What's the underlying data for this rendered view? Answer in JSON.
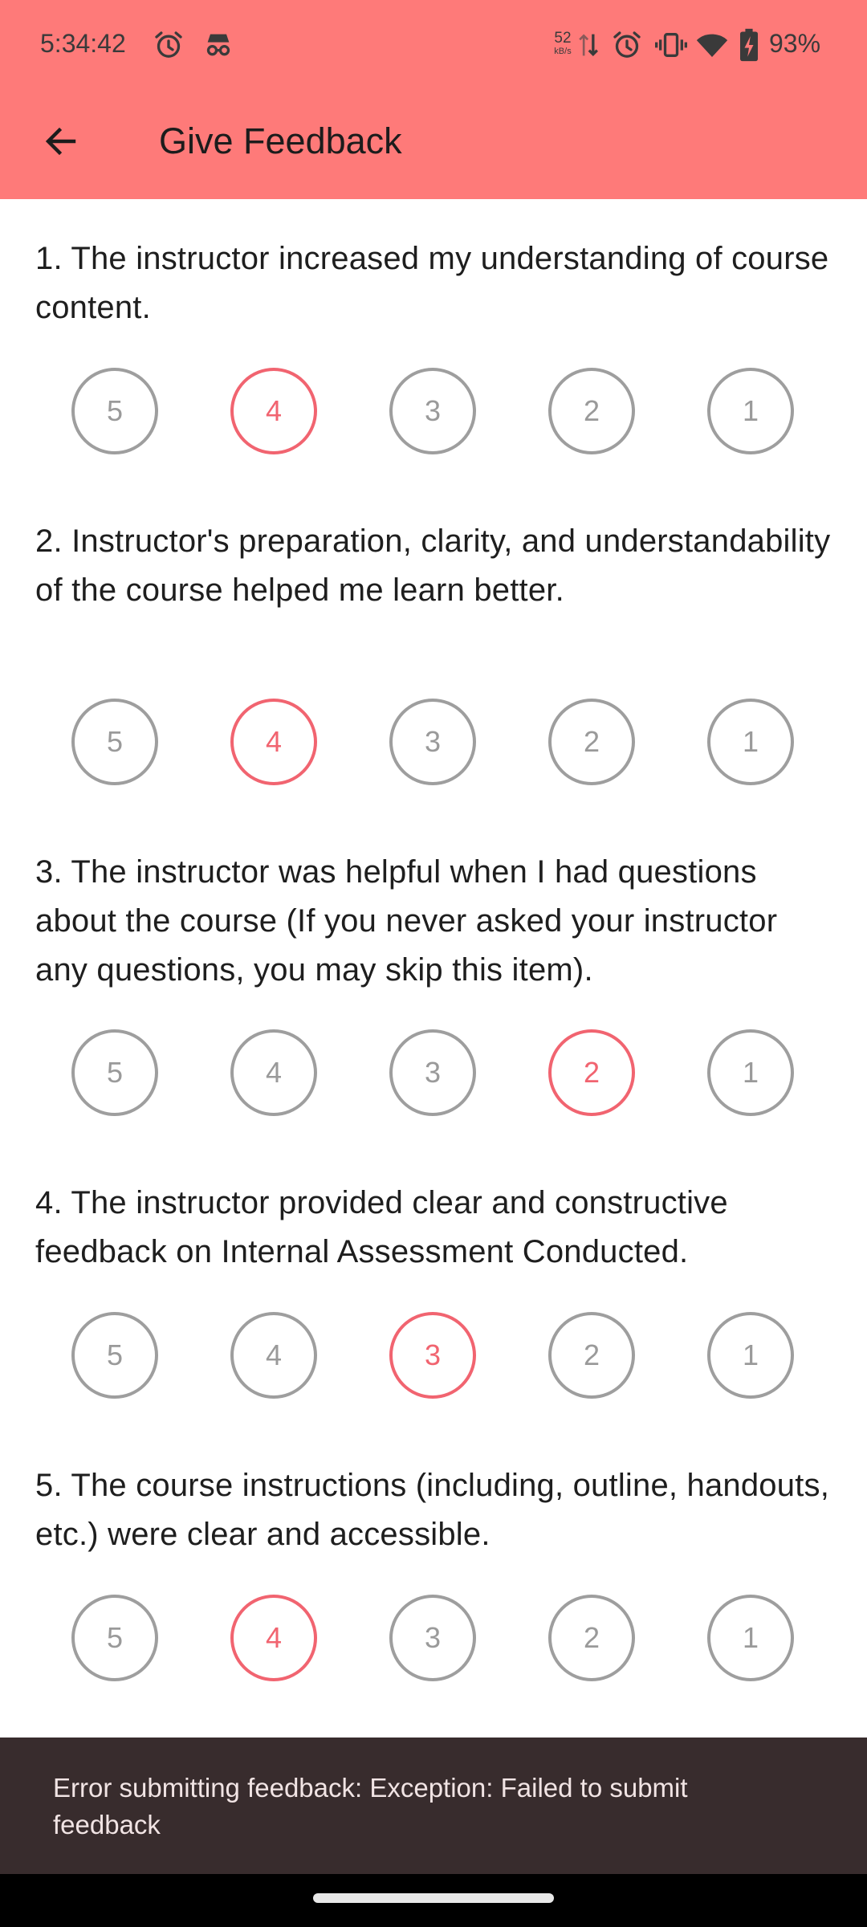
{
  "status_bar": {
    "time": "5:34:42",
    "net_speed_value": "52",
    "net_speed_unit": "kB/s",
    "battery_percent": "93%",
    "icons": [
      "alarm-icon",
      "incognito-icon",
      "data-transfer-icon",
      "alarm-icon",
      "vibrate-icon",
      "wifi-icon",
      "battery-charging-icon"
    ]
  },
  "toolbar": {
    "back_icon": "arrow-back-icon",
    "title": "Give Feedback"
  },
  "rating_scale": [
    "5",
    "4",
    "3",
    "2",
    "1"
  ],
  "questions": [
    {
      "text": "1. The instructor increased my understanding of course content.",
      "selected": "4"
    },
    {
      "text": "2. Instructor's preparation, clarity, and understandability of the course helped me learn better.",
      "selected": "4"
    },
    {
      "text": "3. The instructor was helpful when I had questions about the course (If you never asked your instructor any questions, you may skip this item).",
      "selected": "2"
    },
    {
      "text": "4. The instructor provided clear and constructive feedback on Internal Assessment Conducted.",
      "selected": "3"
    },
    {
      "text": "5. The course instructions (including, outline, handouts, etc.) were clear and accessible.",
      "selected": "4"
    }
  ],
  "snackbar": {
    "message": "Error submitting feedback: Exception: Failed to submit feedback"
  },
  "colors": {
    "app_bar": "#fe7a79",
    "selected": "#f16470",
    "unselected": "#9e9e9e",
    "snackbar": "#382c2d"
  }
}
